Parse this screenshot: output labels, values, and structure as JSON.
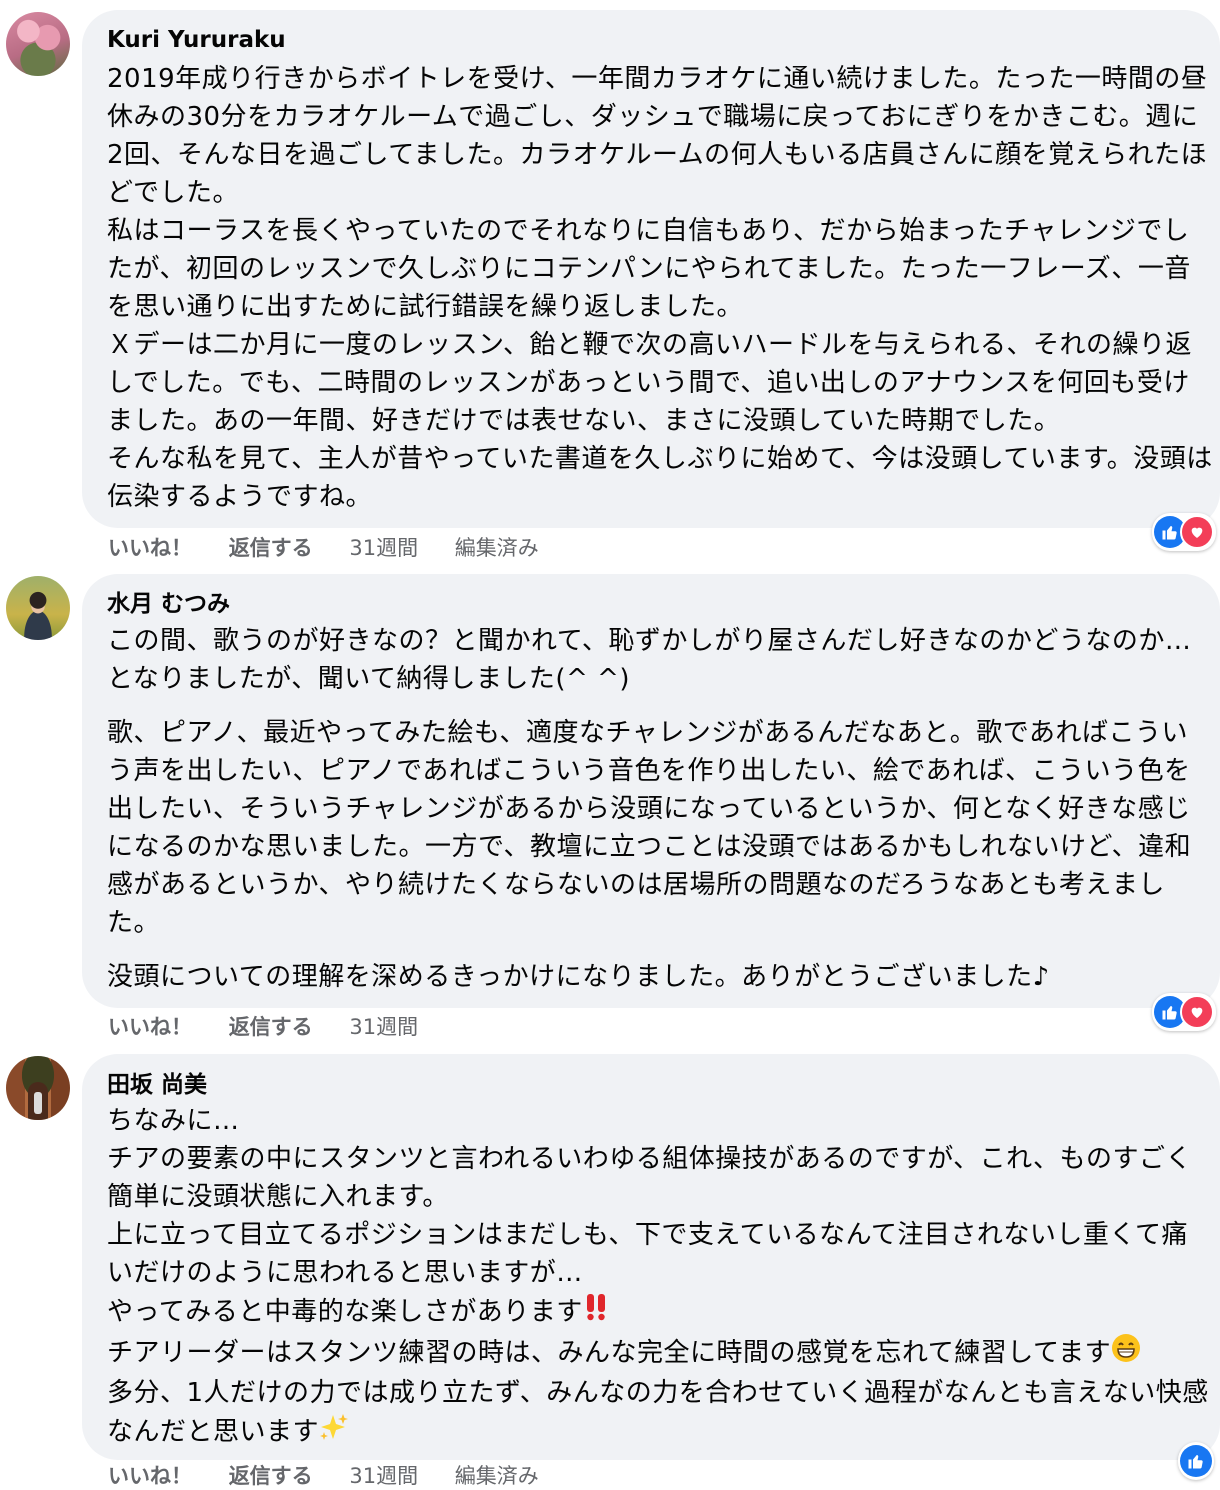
{
  "comments": [
    {
      "author": "Kuri Yururaku",
      "paragraphs": [
        "2019年成り行きからボイトレを受け、一年間カラオケに通い続けました。たった一時間の昼休みの30分をカラオケルームで過ごし、ダッシュで職場に戻っておにぎりをかきこむ。週に2回、そんな日を過ごしてました。カラオケルームの何人もいる店員さんに顔を覚えられたほどでした。\n私はコーラスを長くやっていたのでそれなりに自信もあり、だから始まったチャレンジでしたが、初回のレッスンで久しぶりにコテンパンにやられてました。たった一フレーズ、一音を思い通りに出すために試行錯誤を繰り返しました。\nＸデーは二か月に一度のレッスン、飴と鞭で次の高いハードルを与えられる、それの繰り返しでした。でも、二時間のレッスンがあっという間で、追い出しのアナウンスを何回も受けました。あの一年間、好きだけでは表せない、まさに没頭していた時期でした。\nそんな私を見て、主人が昔やっていた書道を久しぶりに始めて、今は没頭しています。没頭は伝染するようですね。"
      ],
      "like": "いいね！",
      "reply": "返信する",
      "time": "31週間",
      "edited": "編集済み"
    },
    {
      "author": "水月 むつみ",
      "paragraphs": [
        "この間、歌うのが好きなの？と聞かれて、恥ずかしがり屋さんだし好きなのかどうなのか…となりましたが、聞いて納得しました(^ ^)",
        "歌、ピアノ、最近やってみた絵も、適度なチャレンジがあるんだなあと。歌であればこういう声を出したい、ピアノであればこういう音色を作り出したい、絵であれば、こういう色を出したい、そういうチャレンジがあるから没頭になっているというか、何となく好きな感じになるのかな思いました。一方で、教壇に立つことは没頭ではあるかもしれないけど、違和感があるというか、やり続けたくならないのは居場所の問題なのだろうなあとも考えました。",
        "没頭についての理解を深めるきっかけになりました。ありがとうございました♪"
      ],
      "like": "いいね！",
      "reply": "返信する",
      "time": "31週間"
    },
    {
      "author": "田坂 尚美",
      "lines": {
        "l1": "ちなみに…",
        "l2": "チアの要素の中にスタンツと言われるいわゆる組体操技があるのですが、これ、ものすごく簡単に没頭状態に入れます。",
        "l3": "上に立って目立てるポジションはまだしも、下で支えているなんて注目されないし重くて痛いだけのように思われると思いますが…",
        "l4": "やってみると中毒的な楽しさがあります",
        "l5": "チアリーダーはスタンツ練習の時は、みんな完全に時間の感覚を忘れて練習してます",
        "l6": "多分、1人だけの力では成り立たず、みんなの力を合わせていく過程がなんとも言えない快感なんだと思います"
      },
      "like": "いいね！",
      "reply": "返信する",
      "time": "31週間",
      "edited": "編集済み"
    }
  ],
  "icons": {
    "like": "like-icon",
    "love": "love-icon",
    "exclamation": "double-exclamation-icon",
    "grin": "grinning-face-icon",
    "sparkles": "sparkles-icon"
  },
  "colors": {
    "bubble": "#f0f2f5",
    "like": "#1877f2",
    "love": "#f33e58",
    "meta": "#65676b"
  }
}
